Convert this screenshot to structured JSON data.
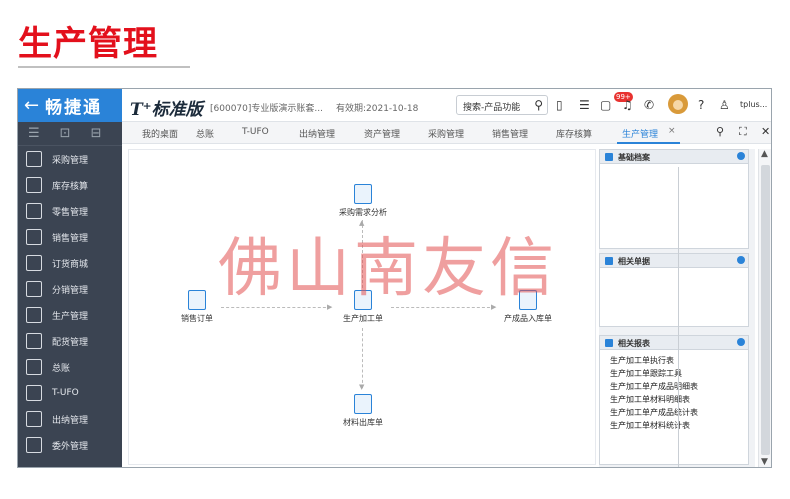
{
  "page_heading": "生产管理",
  "topbar": {
    "back_icon": "←",
    "brand": "畅捷通",
    "product": "T⁺标准版",
    "account": "[600070]专业版演示账套...",
    "expiry": "有效期:2021-10-18",
    "search_placeholder": "搜索-产品功能",
    "notification_badge": "99+",
    "user": "tplus..."
  },
  "sidebar": {
    "items": [
      {
        "label": "采购管理",
        "icon": "purchase-icon"
      },
      {
        "label": "库存核算",
        "icon": "inventory-icon"
      },
      {
        "label": "零售管理",
        "icon": "retail-icon"
      },
      {
        "label": "销售管理",
        "icon": "sales-icon"
      },
      {
        "label": "订货商城",
        "icon": "mall-icon"
      },
      {
        "label": "分销管理",
        "icon": "distribution-icon"
      },
      {
        "label": "生产管理",
        "icon": "production-icon"
      },
      {
        "label": "配货管理",
        "icon": "delivery-icon"
      },
      {
        "label": "总账",
        "icon": "ledger-icon"
      },
      {
        "label": "T-UFO",
        "icon": "ufo-icon"
      },
      {
        "label": "出纳管理",
        "icon": "cashier-icon"
      },
      {
        "label": "委外管理",
        "icon": "outsource-icon"
      }
    ]
  },
  "tabs": [
    {
      "label": "我的桌面"
    },
    {
      "label": "总账"
    },
    {
      "label": "T-UFO"
    },
    {
      "label": "出纳管理"
    },
    {
      "label": "资产管理"
    },
    {
      "label": "采购管理"
    },
    {
      "label": "销售管理"
    },
    {
      "label": "库存核算"
    },
    {
      "label": "生产管理"
    }
  ],
  "flow": {
    "purchase_analysis": "采购需求分析",
    "sales_order": "销售订单",
    "production_order": "生产加工单",
    "finished_goods_in": "产成品入库单",
    "material_out": "材料出库单"
  },
  "watermark": "佛山南友信",
  "panels": {
    "basic_archive": "基础档案",
    "related_docs": "相关单据",
    "related_reports": "相关报表",
    "reports": [
      "生产加工单执行表",
      "生产加工单跟踪工具",
      "生产加工单产成品明细表",
      "生产加工单材料明细表",
      "生产加工单产成品统计表",
      "生产加工单材料统计表"
    ]
  },
  "colors": {
    "brand_blue": "#2a83d8",
    "sidebar_bg": "#3b4452",
    "heading_red": "#e3101c"
  }
}
